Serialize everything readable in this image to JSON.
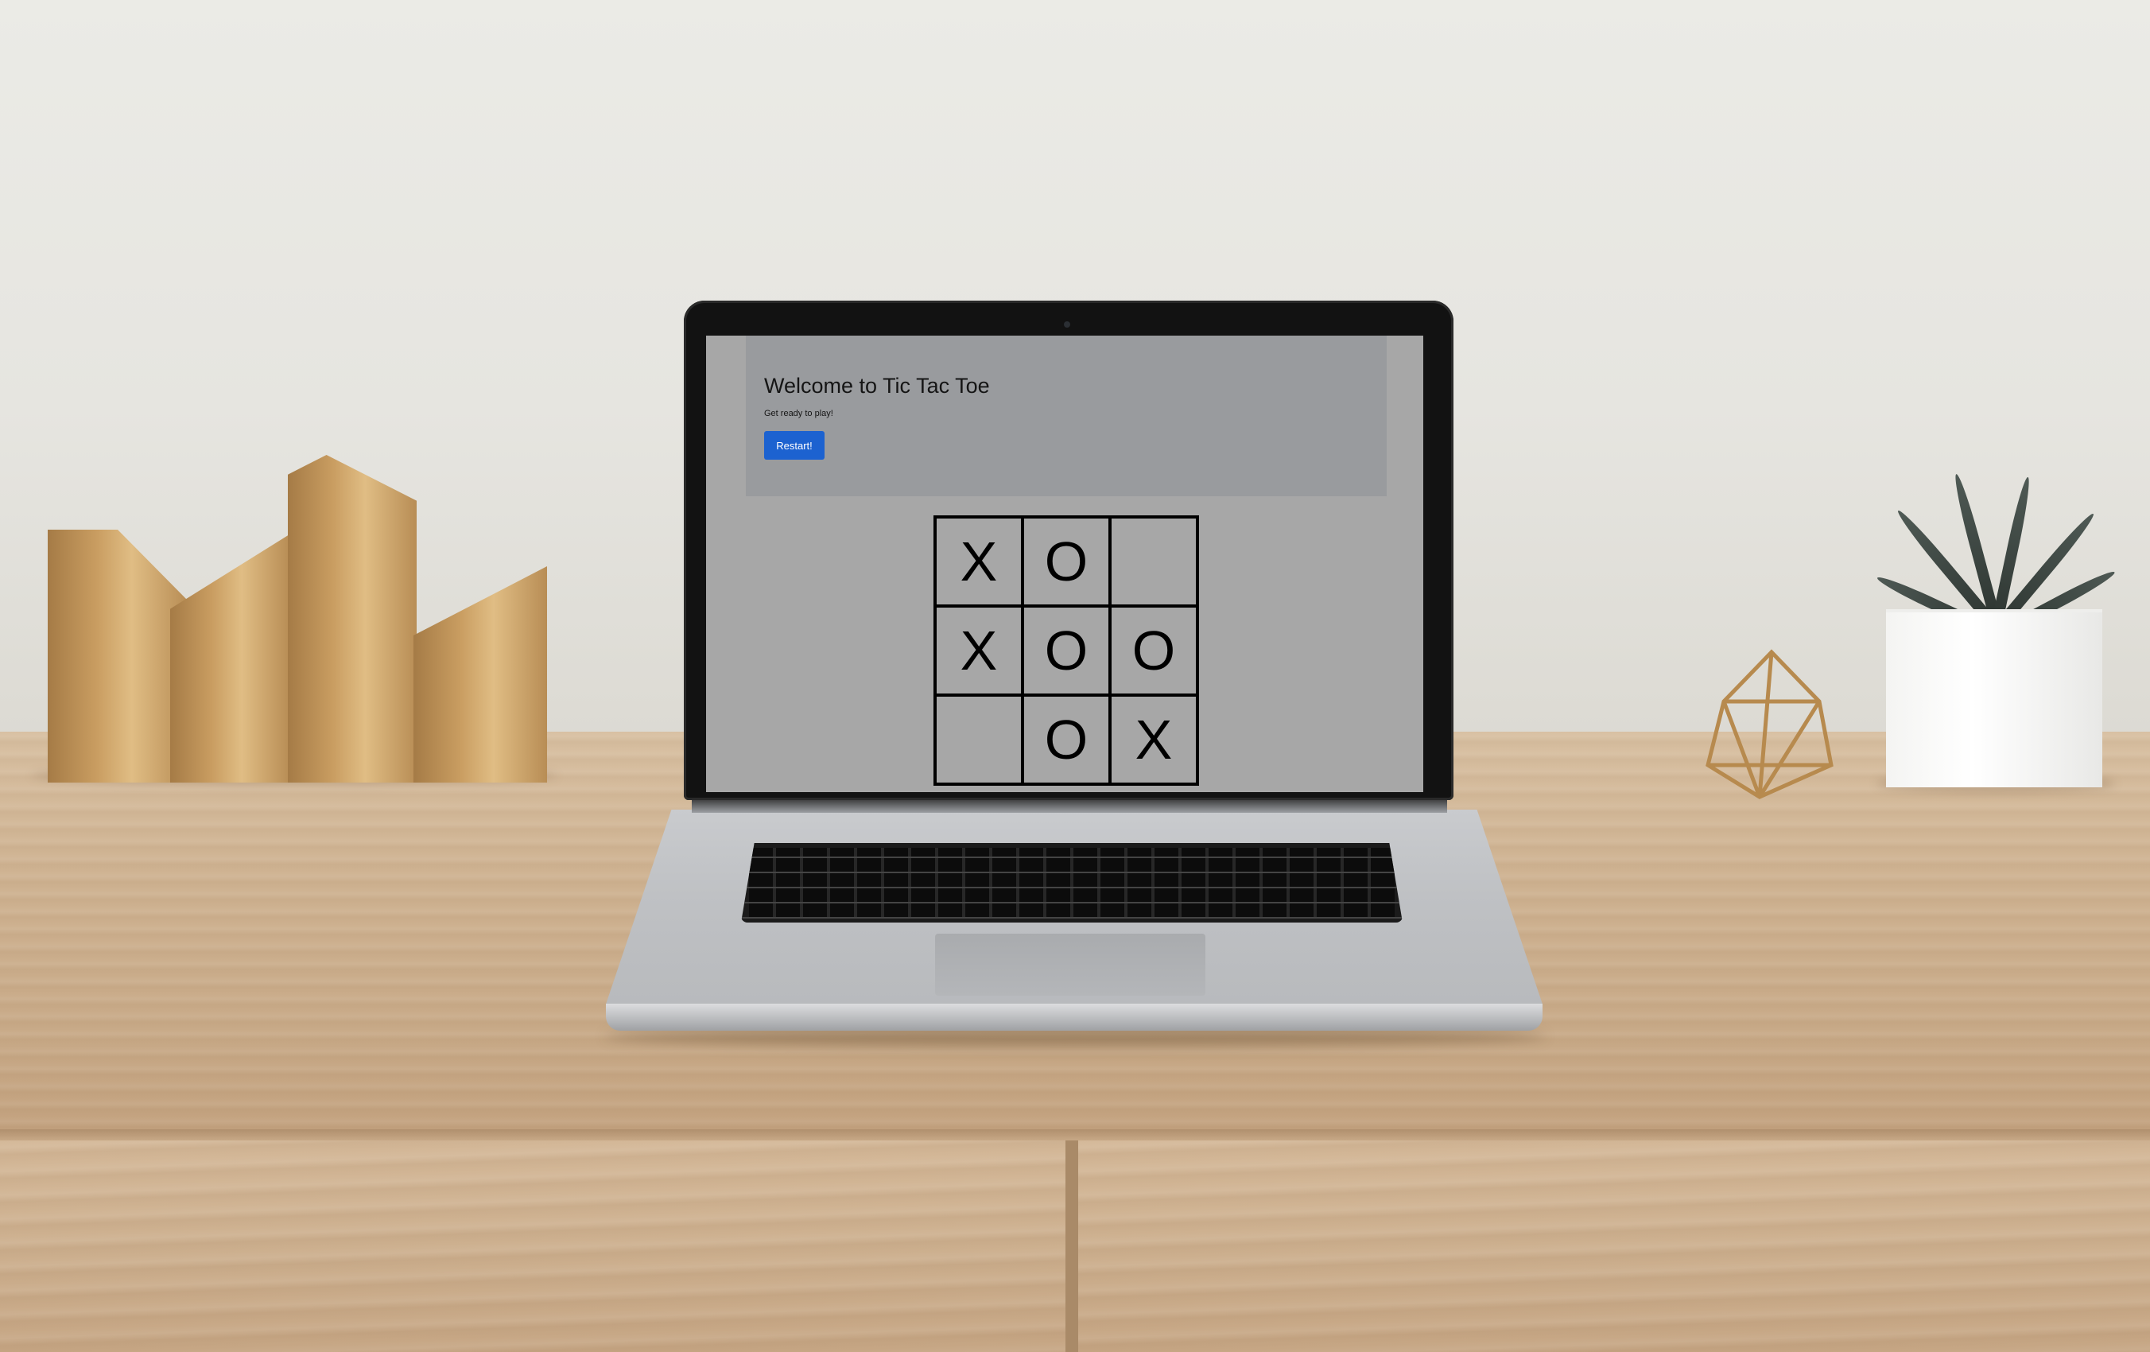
{
  "app": {
    "hero": {
      "title": "Welcome to Tic Tac Toe",
      "subtitle": "Get ready to play!",
      "restart_label": "Restart!"
    },
    "board": {
      "cells": [
        "X",
        "O",
        "",
        "X",
        "O",
        "O",
        "",
        "O",
        "X"
      ]
    }
  },
  "colors": {
    "page_background": "#a7a7a7",
    "hero_background": "#999b9e",
    "restart_button": "#1c62d0",
    "grid_lines": "#000000"
  }
}
